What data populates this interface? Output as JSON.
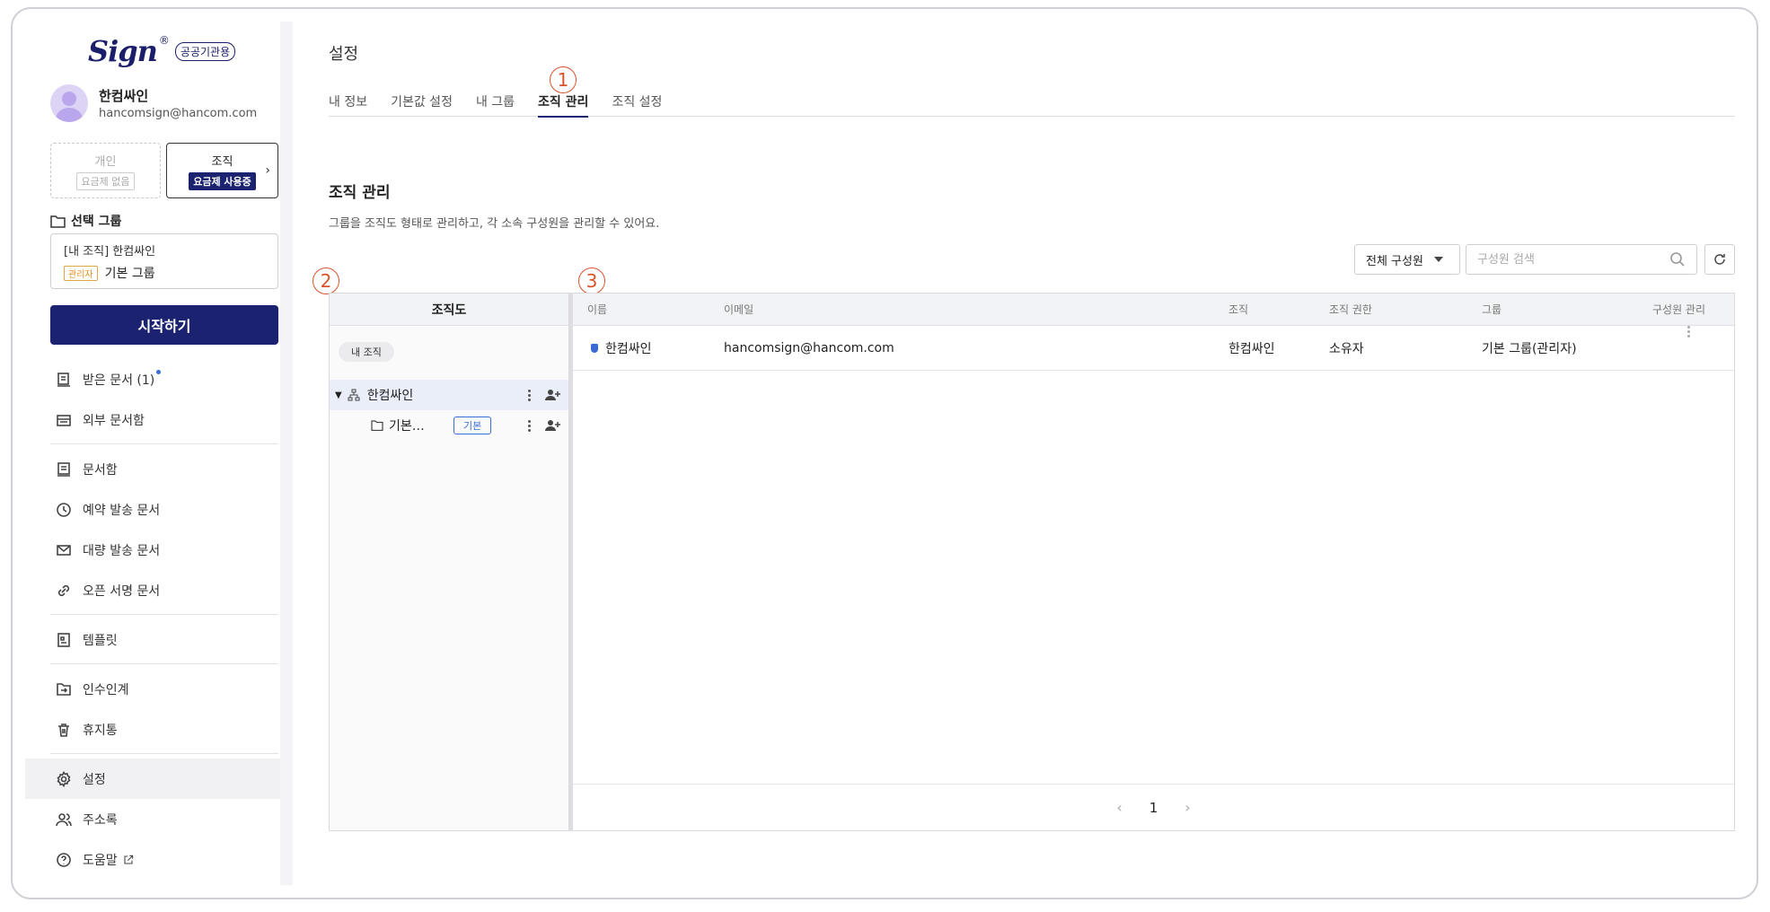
{
  "brand": {
    "logo": "Sign",
    "reg": "®",
    "badge": "공공기관용"
  },
  "profile": {
    "name": "한컴싸인",
    "email": "hancomsign@hancom.com"
  },
  "plans": {
    "personal": {
      "title": "개인",
      "tag": "요금제 없음"
    },
    "org": {
      "title": "조직",
      "tag": "요금제 사용중"
    }
  },
  "group": {
    "label": "선택 그룹",
    "line1": "[내 조직]  한컴싸인",
    "admin_tag": "관리자",
    "name": "기본 그룹"
  },
  "start_label": "시작하기",
  "nav": {
    "received": "받은 문서 (1)",
    "external": "외부 문서함",
    "docbox": "문서함",
    "scheduled": "예약 발송 문서",
    "bulk": "대량 발송 문서",
    "open_sign": "오픈 서명 문서",
    "template": "템플릿",
    "handover": "인수인계",
    "trash": "휴지통",
    "settings": "설정",
    "contacts": "주소록",
    "help": "도움말"
  },
  "main": {
    "title": "설정",
    "tabs": [
      "내 정보",
      "기본값 설정",
      "내 그룹",
      "조직 관리",
      "조직 설정"
    ],
    "markers": [
      "1",
      "2",
      "3"
    ],
    "section_title": "조직 관리",
    "section_desc": "그룹을 조직도 형태로 관리하고, 각 소속 구성원을 관리할 수 있어요.",
    "filter_value": "전체 구성원",
    "search_placeholder": "구성원 검색"
  },
  "org_tree": {
    "header": "조직도",
    "my_org_pill": "내 조직",
    "root": "한컴싸인",
    "child": "기본…",
    "child_tag": "기본"
  },
  "members": {
    "columns": [
      "이름",
      "이메일",
      "조직",
      "조직 권한",
      "그룹",
      "구성원 관리"
    ],
    "rows": [
      {
        "name": "한컴싸인",
        "email": "hancomsign@hancom.com",
        "org": "한컴싸인",
        "role": "소유자",
        "group": "기본 그룹(관리자)"
      }
    ],
    "page": "1"
  },
  "colors": {
    "brand": "#1b2371",
    "marker": "#d9532c",
    "link": "#3a6bd4"
  }
}
